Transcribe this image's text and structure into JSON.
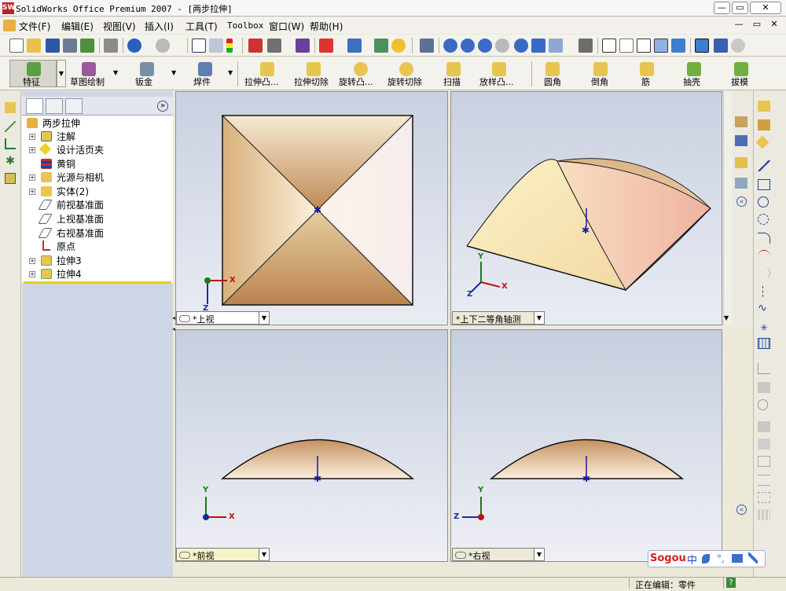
{
  "window": {
    "title": "SolidWorks Office Premium 2007 - [两步拉伸]",
    "app_icon_text": "SW",
    "controls": {
      "minimize": "—",
      "restore": "▭",
      "close": "✕"
    },
    "doc_controls": {
      "minimize": "—",
      "restore": "▭",
      "close": "✕"
    }
  },
  "menu": {
    "items": [
      "文件(F)",
      "编辑(E)",
      "视图(V)",
      "插入(I)",
      "工具(T)",
      "Toolbox",
      "窗口(W)",
      "帮助(H)"
    ]
  },
  "feature_toolbar": {
    "items": [
      {
        "label": "特征"
      },
      {
        "label": "草图绘制"
      },
      {
        "label": "钣金"
      },
      {
        "label": "焊件"
      },
      {
        "label": "拉伸凸..."
      },
      {
        "label": "拉伸切除"
      },
      {
        "label": "旋转凸..."
      },
      {
        "label": "旋转切除"
      },
      {
        "label": "扫描"
      },
      {
        "label": "放样凸..."
      },
      {
        "label": "圆角"
      },
      {
        "label": "倒角"
      },
      {
        "label": "筋"
      },
      {
        "label": "抽壳"
      },
      {
        "label": "拔模"
      }
    ]
  },
  "tree": {
    "collapse_glyph": "»",
    "items": [
      {
        "label": "两步拉伸"
      },
      {
        "label": "注解"
      },
      {
        "label": "设计活页夹"
      },
      {
        "label": "黄铜"
      },
      {
        "label": "光源与相机"
      },
      {
        "label": "实体(2)"
      },
      {
        "label": "前视基准面"
      },
      {
        "label": "上视基准面"
      },
      {
        "label": "右视基准面"
      },
      {
        "label": "原点"
      },
      {
        "label": "拉伸3"
      },
      {
        "label": "拉伸4"
      }
    ]
  },
  "viewports": [
    {
      "label": "*上视",
      "axes": [
        "X",
        "Z"
      ]
    },
    {
      "label": "*上下二等角轴测",
      "axes": [
        "Y",
        "X",
        "Z"
      ]
    },
    {
      "label": "*前视",
      "axes": [
        "Y",
        "X"
      ]
    },
    {
      "label": "*右视",
      "axes": [
        "Y",
        "Z"
      ]
    }
  ],
  "status": {
    "editing": "正在编辑：零件",
    "help_icon": "?"
  },
  "ime": {
    "logo": "Sogou",
    "mode": "中"
  },
  "colors": {
    "model_light": "#fbf3e4",
    "model_dark": "#c38a52",
    "rollback_bar": "#e6d300"
  }
}
